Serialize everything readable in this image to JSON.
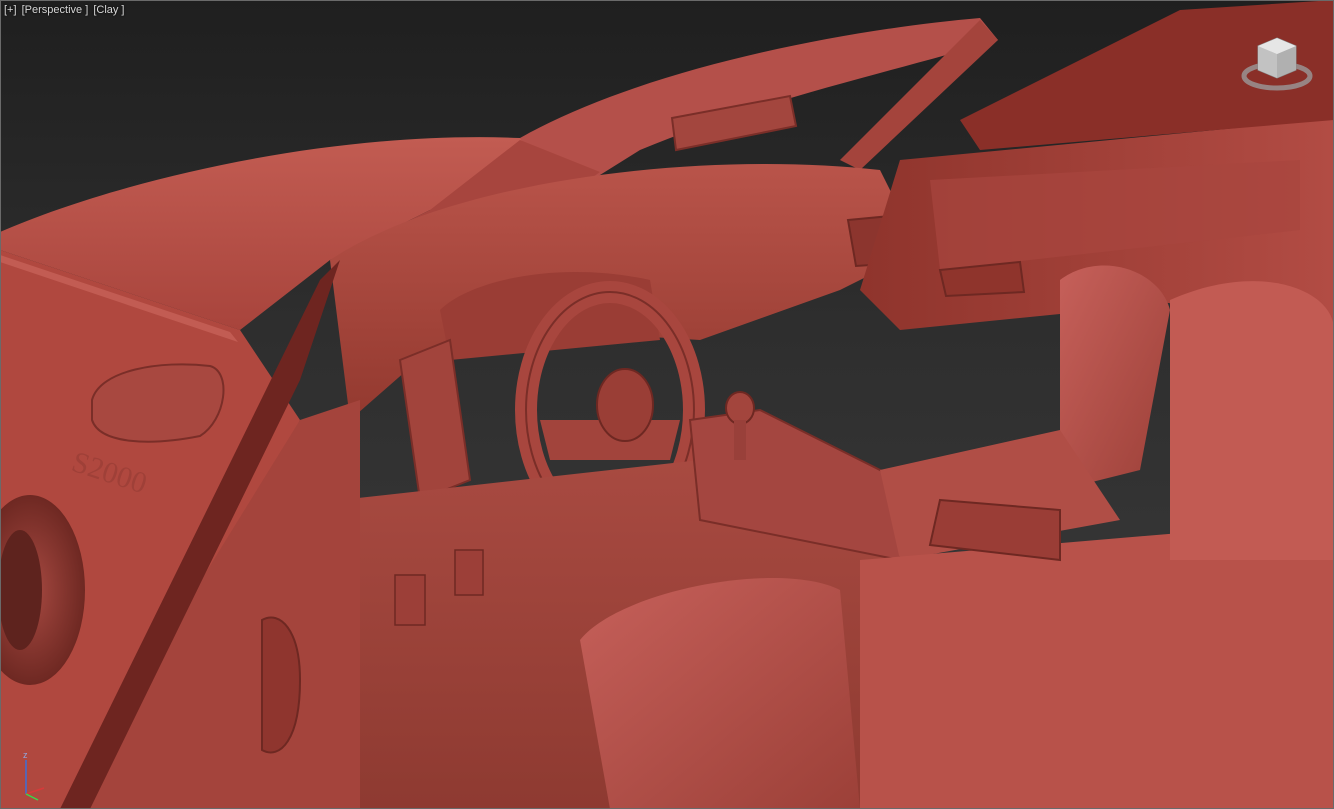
{
  "viewport": {
    "menu_label": "[+]",
    "view_label": "[Perspective ]",
    "shading_label": "[Clay ]"
  },
  "viewcube": {
    "icon": "viewcube-icon"
  },
  "axis_tripod": {
    "icon": "axis-tripod-icon",
    "z_label": "z"
  },
  "colors": {
    "clay_base": "#b8524a",
    "clay_light": "#c9645a",
    "clay_shadow": "#7a2e28",
    "background_top": "#1f1f1f",
    "background_bottom": "#3c3c3c",
    "label_text": "#d8d8d8"
  }
}
